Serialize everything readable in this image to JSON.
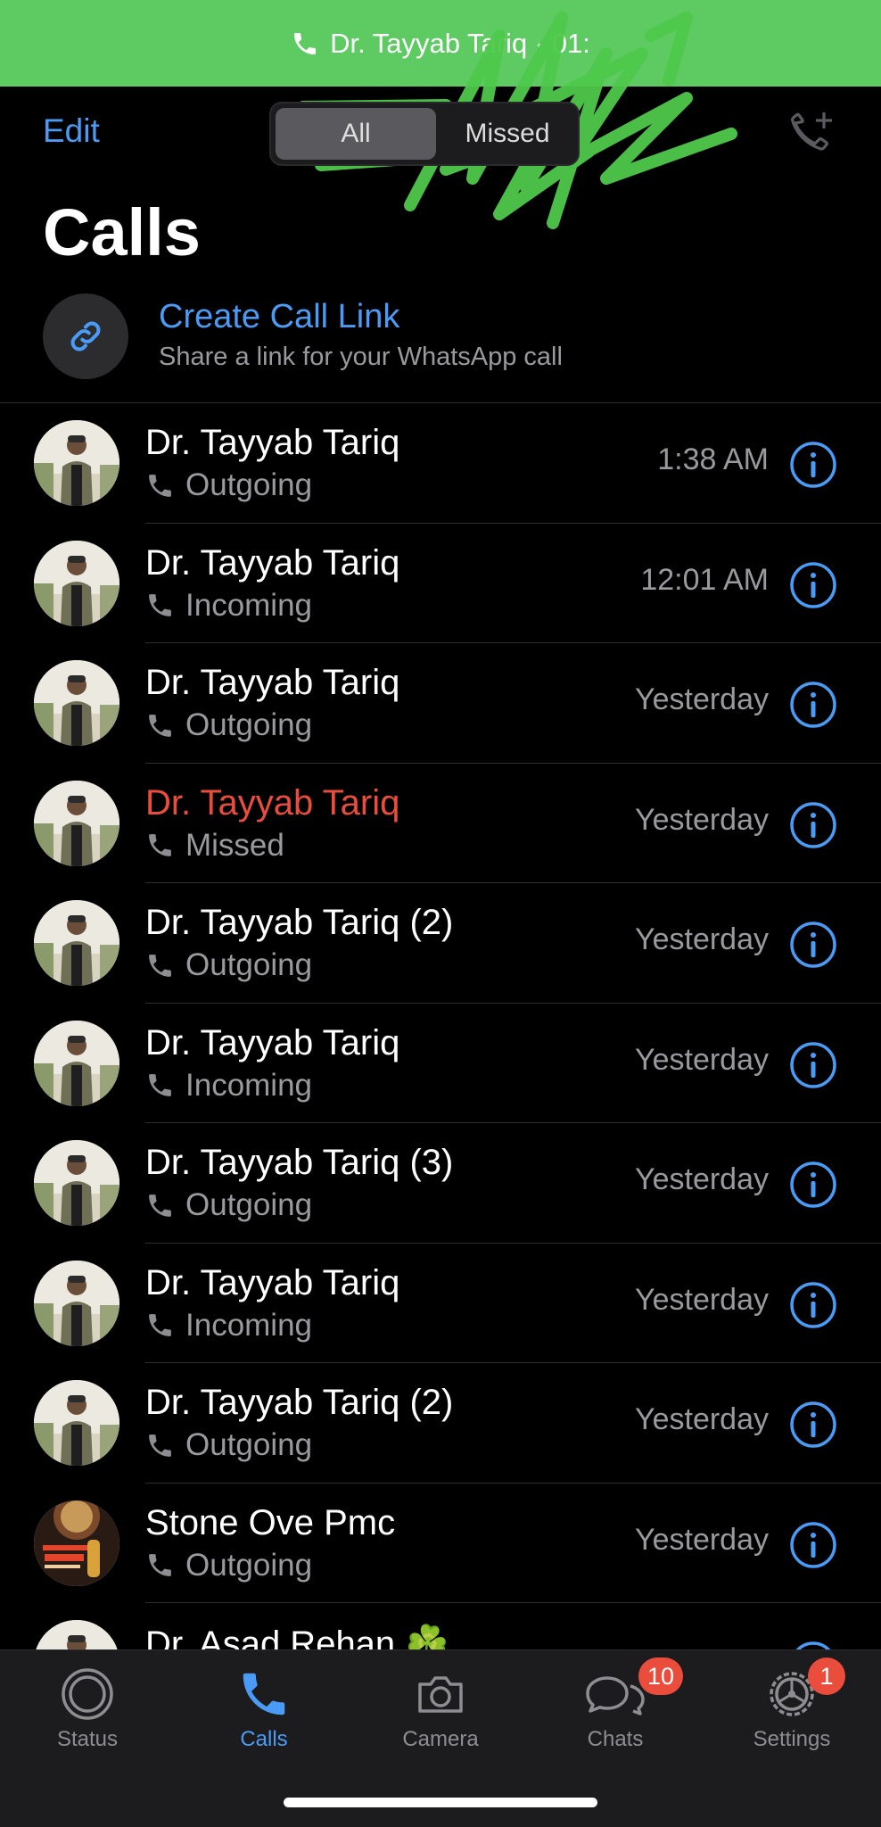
{
  "banner": {
    "text": "Dr. Tayyab Tariq · 01:"
  },
  "header": {
    "edit_label": "Edit",
    "segments": [
      "All",
      "Missed"
    ],
    "title": "Calls"
  },
  "call_link": {
    "title": "Create Call Link",
    "subtitle": "Share a link for your WhatsApp call"
  },
  "calls": [
    {
      "name": "Dr. Tayyab Tariq",
      "type": "Outgoing",
      "time": "1:38 AM",
      "missed": false,
      "avatar": "person"
    },
    {
      "name": "Dr. Tayyab Tariq",
      "type": "Incoming",
      "time": "12:01 AM",
      "missed": false,
      "avatar": "person"
    },
    {
      "name": "Dr. Tayyab Tariq",
      "type": "Outgoing",
      "time": "Yesterday",
      "missed": false,
      "avatar": "person"
    },
    {
      "name": "Dr. Tayyab Tariq",
      "type": "Missed",
      "time": "Yesterday",
      "missed": true,
      "avatar": "person"
    },
    {
      "name": "Dr. Tayyab Tariq  (2)",
      "type": "Outgoing",
      "time": "Yesterday",
      "missed": false,
      "avatar": "person"
    },
    {
      "name": "Dr. Tayyab Tariq",
      "type": "Incoming",
      "time": "Yesterday",
      "missed": false,
      "avatar": "person"
    },
    {
      "name": "Dr. Tayyab Tariq  (3)",
      "type": "Outgoing",
      "time": "Yesterday",
      "missed": false,
      "avatar": "person"
    },
    {
      "name": "Dr. Tayyab Tariq",
      "type": "Incoming",
      "time": "Yesterday",
      "missed": false,
      "avatar": "person"
    },
    {
      "name": "Dr. Tayyab Tariq  (2)",
      "type": "Outgoing",
      "time": "Yesterday",
      "missed": false,
      "avatar": "person"
    },
    {
      "name": "Stone Ove Pmc",
      "type": "Outgoing",
      "time": "Yesterday",
      "missed": false,
      "avatar": "poster"
    },
    {
      "name": "Dr. Asad Rehan ☘️",
      "type": "",
      "time": "",
      "missed": false,
      "avatar": "person2"
    }
  ],
  "tabs": [
    {
      "label": "Status",
      "icon": "status-icon",
      "badge": ""
    },
    {
      "label": "Calls",
      "icon": "phone-icon",
      "badge": ""
    },
    {
      "label": "Camera",
      "icon": "camera-icon",
      "badge": ""
    },
    {
      "label": "Chats",
      "icon": "chats-icon",
      "badge": "10"
    },
    {
      "label": "Settings",
      "icon": "gear-icon",
      "badge": "1"
    }
  ],
  "colors": {
    "accent": "#4a9bf5",
    "missed": "#eb4d3d",
    "banner": "#5ecb62"
  }
}
